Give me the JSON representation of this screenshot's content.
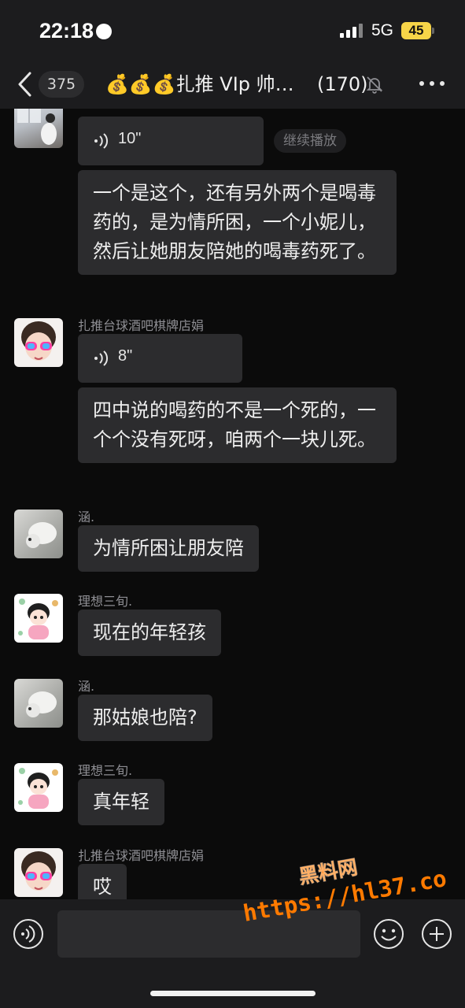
{
  "status_bar": {
    "time": "22:18",
    "network": "5G",
    "battery": "45"
  },
  "header": {
    "back_count": "375",
    "title": "💰💰💰扎推 VIp 帅…",
    "member_count": "(170)"
  },
  "messages": [
    {
      "sender": "",
      "type": "voice",
      "duration": "10\"",
      "play_label": "继续播放"
    },
    {
      "sender": "",
      "type": "text",
      "text": "一个是这个，还有另外两个是喝毒药的，是为情所困，一个小妮儿，然后让她朋友陪她的喝毒药死了。"
    },
    {
      "sender": "扎推台球酒吧棋牌店娟",
      "type": "voice",
      "duration": "8\""
    },
    {
      "sender": "",
      "type": "text",
      "text": "四中说的喝药的不是一个死的，一个个没有死呀，咱两个一块儿死。"
    },
    {
      "sender": "涵.",
      "type": "text",
      "text": "为情所困让朋友陪"
    },
    {
      "sender": "理想三旬.",
      "type": "text",
      "text": "现在的年轻孩"
    },
    {
      "sender": "涵.",
      "type": "text",
      "text": "那姑娘也陪?"
    },
    {
      "sender": "理想三旬.",
      "type": "text",
      "text": "真年轻"
    },
    {
      "sender": "扎推台球酒吧棋牌店娟",
      "type": "text",
      "text": "哎"
    }
  ],
  "input": {
    "placeholder": ""
  },
  "watermark": {
    "line1": "黑料网",
    "line2": "https://hl37.co"
  },
  "colors": {
    "bubble": "#2c2c2e",
    "bar": "#1c1c1e",
    "watermark": "#ff7a00"
  }
}
